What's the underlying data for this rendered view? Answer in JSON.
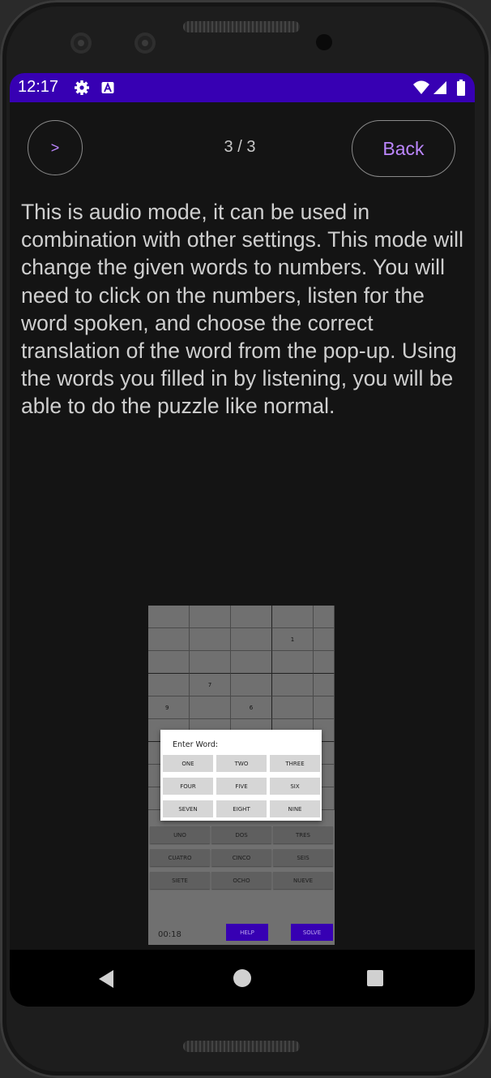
{
  "status_bar": {
    "time": "12:17",
    "icons": [
      "gear-icon",
      "a-icon",
      "wifi-icon",
      "signal-icon",
      "battery-icon"
    ],
    "color": "#3700b3"
  },
  "header": {
    "next_label": ">",
    "page_indicator": "3 / 3",
    "back_label": "Back"
  },
  "description": "This is audio mode, it can be used in combination with other settings. This mode will change the given words to numbers. You will need to click on the numbers, listen for the word spoken, and choose the correct translation of the word from the pop-up. Using the words you filled in by listening, you will be able to do the puzzle like normal.",
  "screenshot": {
    "grid_numbers": [
      "1",
      "7",
      "9",
      "6"
    ],
    "dialog": {
      "title": "Enter Word:",
      "options": [
        "ONE",
        "TWO",
        "THREE",
        "FOUR",
        "FIVE",
        "SIX",
        "SEVEN",
        "EIGHT",
        "NINE"
      ]
    },
    "answer_buttons": [
      "UNO",
      "DOS",
      "TRES",
      "CUATRO",
      "CINCO",
      "SEIS",
      "SIETE",
      "OCHO",
      "NUEVE"
    ],
    "timer": "00:18",
    "help_label": "HELP",
    "solve_label": "SOLVE"
  },
  "navigation": [
    "back-icon",
    "home-icon",
    "recents-icon"
  ]
}
